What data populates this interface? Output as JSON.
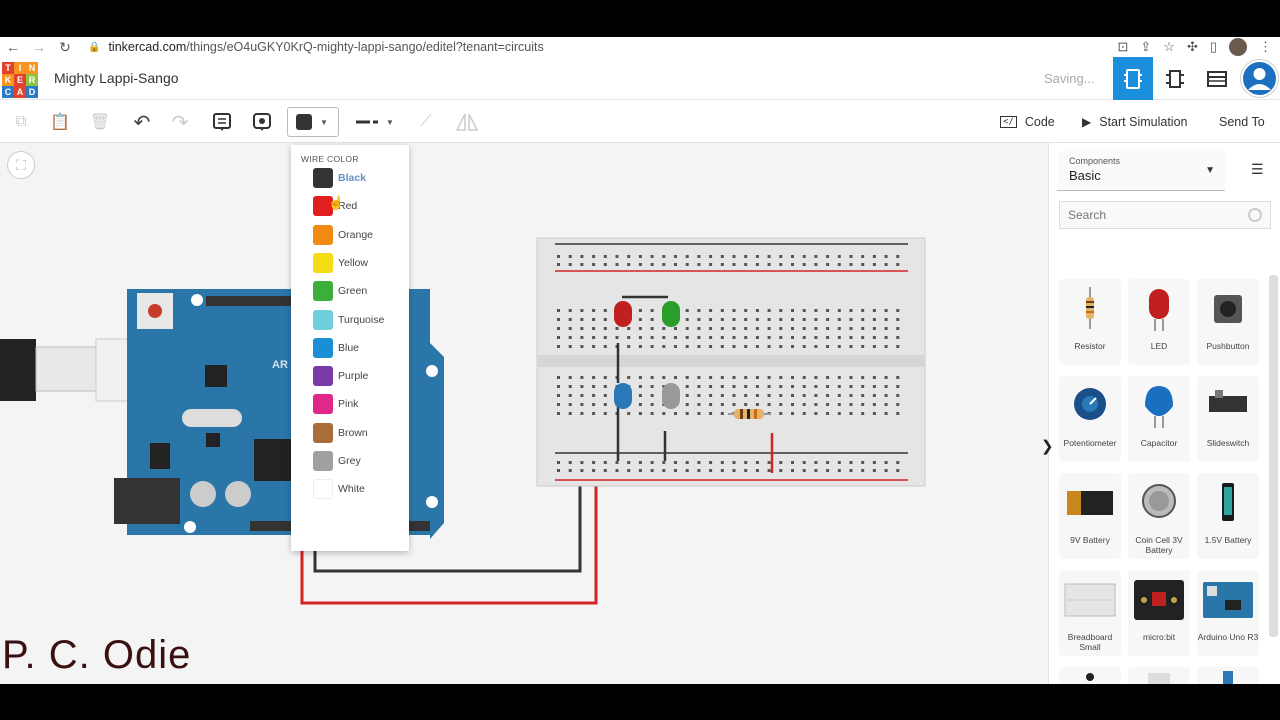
{
  "browser": {
    "url_host": "tinkercad.com",
    "url_path": "/things/eO4uGKY0KrQ-mighty-lappi-sango/editel?tenant=circuits"
  },
  "app": {
    "logo_letters": [
      "T",
      "I",
      "N",
      "K",
      "E",
      "R",
      "C",
      "A",
      "D"
    ],
    "logo_colors": [
      "#e2422b",
      "#f7941d",
      "#f7941d",
      "#f7941d",
      "#e2422b",
      "#8cc63f",
      "#2a7bc4",
      "#e2422b",
      "#2a7bc4"
    ],
    "title": "Mighty Lappi-Sango",
    "status": "Saving...",
    "accent": "#1c8fdc"
  },
  "toolbar": {
    "code_label": "Code",
    "simulate_label": "Start Simulation",
    "send_label": "Send To"
  },
  "wire_menu": {
    "heading": "WIRE COLOR",
    "selected": "Black",
    "colors": [
      {
        "label": "Black",
        "hex": "#333333"
      },
      {
        "label": "Red",
        "hex": "#e02020"
      },
      {
        "label": "Orange",
        "hex": "#f08a13"
      },
      {
        "label": "Yellow",
        "hex": "#f5dd16"
      },
      {
        "label": "Green",
        "hex": "#3cae3c"
      },
      {
        "label": "Turquoise",
        "hex": "#6fd0dc"
      },
      {
        "label": "Blue",
        "hex": "#1a8fd6"
      },
      {
        "label": "Purple",
        "hex": "#7a3aa8"
      },
      {
        "label": "Pink",
        "hex": "#e0288c"
      },
      {
        "label": "Brown",
        "hex": "#a86d3a"
      },
      {
        "label": "Grey",
        "hex": "#a0a0a0"
      },
      {
        "label": "White",
        "hex": "#ffffff"
      }
    ]
  },
  "panel": {
    "components_label": "Components",
    "components_value": "Basic",
    "search_placeholder": "Search",
    "items": [
      "Resistor",
      "LED",
      "Pushbutton",
      "Potentiometer",
      "Capacitor",
      "Slideswitch",
      "9V Battery",
      "Coin Cell 3V Battery",
      "1.5V Battery",
      "Breadboard Small",
      "micro:bit",
      "Arduino Uno R3"
    ]
  },
  "watermark": "P. C. Odie"
}
